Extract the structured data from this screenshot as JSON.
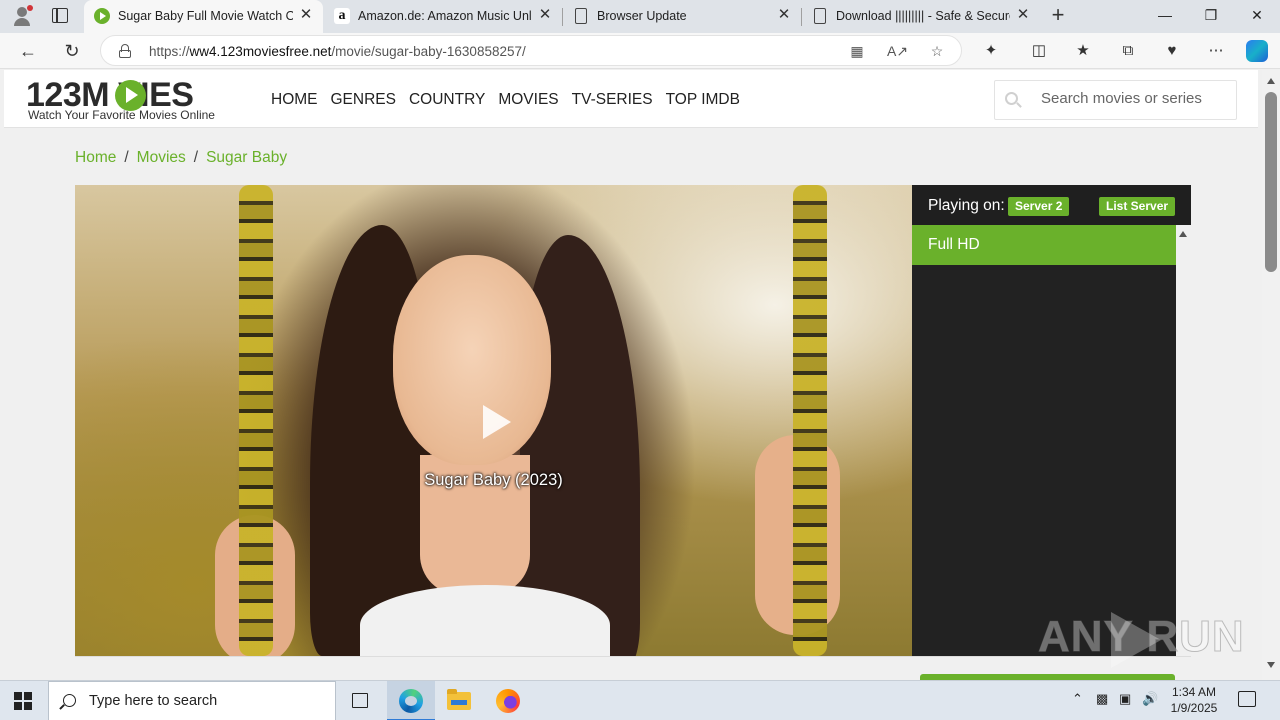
{
  "browser": {
    "tabs": [
      {
        "title": "Sugar Baby Full Movie Watch Online",
        "favicon": "play-circle-icon",
        "active": true
      },
      {
        "title": "Amazon.de: Amazon Music Unlimited",
        "favicon": "amazon-icon",
        "active": false
      },
      {
        "title": "Browser Update",
        "favicon": "document-icon",
        "active": false
      },
      {
        "title": "Download ||||||||| - Safe & Secure",
        "favicon": "document-icon",
        "active": false
      }
    ],
    "close_glyph": "✕",
    "new_tab_glyph": "+",
    "window_controls": {
      "minimize": "—",
      "restore": "❐",
      "close": "✕"
    },
    "url_prefix": "https://",
    "url_host": "ww4.123moviesfree.net",
    "url_path": "/movie/sugar-baby-1630858257/"
  },
  "site": {
    "logo_text": "123M  VIES",
    "tagline": "Watch Your Favorite Movies Online",
    "nav": [
      "HOME",
      "GENRES",
      "COUNTRY",
      "MOVIES",
      "TV-SERIES",
      "TOP IMDB"
    ],
    "search_placeholder": "Search movies or series",
    "accent_color": "#6ab12b"
  },
  "breadcrumb": [
    "Home",
    "Movies",
    "Sugar Baby"
  ],
  "breadcrumb_sep": "/",
  "player": {
    "title": "Sugar Baby (2023)",
    "playing_on_label": "Playing on:",
    "current_server": "Server 2",
    "list_server_label": "List Server",
    "servers": [
      "Full HD"
    ]
  },
  "watermark": "ANY  RUN",
  "taskbar": {
    "search_placeholder": "Type here to search",
    "time": "1:34 AM",
    "date": "1/9/2025"
  }
}
